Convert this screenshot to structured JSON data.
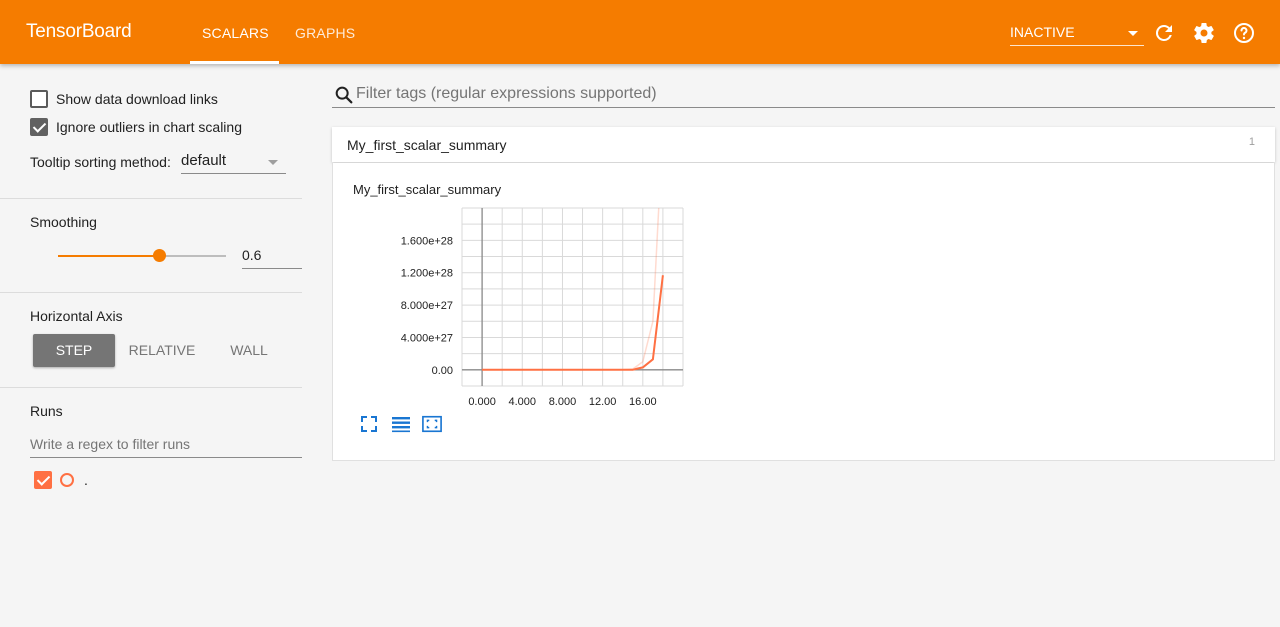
{
  "header": {
    "brand": "TensorBoard",
    "tabs": [
      {
        "label": "SCALARS",
        "active": true
      },
      {
        "label": "GRAPHS",
        "active": false
      }
    ],
    "run_select": "INACTIVE",
    "icons": [
      "refresh-icon",
      "settings-icon",
      "help-icon"
    ],
    "accent": "#f57c00"
  },
  "sidebar": {
    "show_download_links": {
      "label": "Show data download links",
      "checked": false
    },
    "ignore_outliers": {
      "label": "Ignore outliers in chart scaling",
      "checked": true
    },
    "tooltip_sort": {
      "label": "Tooltip sorting method:",
      "value": "default"
    },
    "smoothing": {
      "label": "Smoothing",
      "value": "0.6",
      "level": 0.6
    },
    "horizontal_axis": {
      "label": "Horizontal Axis",
      "options": [
        "STEP",
        "RELATIVE",
        "WALL"
      ],
      "selected": "STEP"
    },
    "runs": {
      "label": "Runs",
      "filter_placeholder": "Write a regex to filter runs",
      "items": [
        {
          "name": ".",
          "checked": true,
          "color": "#ff7043"
        }
      ]
    }
  },
  "main": {
    "search_placeholder": "Filter tags (regular expressions supported)",
    "category": {
      "title": "My_first_scalar_summary",
      "count": "1"
    },
    "card": {
      "title": "My_first_scalar_summary"
    },
    "card_tools": [
      "fit-domain-icon",
      "data-list-icon",
      "expand-chart-icon"
    ]
  },
  "chart_data": {
    "type": "line",
    "title": "My_first_scalar_summary",
    "xlabel": "",
    "ylabel": "",
    "x_ticks": [
      "0.000",
      "4.000",
      "8.000",
      "12.00",
      "16.00"
    ],
    "y_ticks": [
      "1.600e+28",
      "1.200e+28",
      "8.000e+27",
      "4.000e+27",
      "0.00"
    ],
    "xlim": [
      -2,
      20
    ],
    "ylim": [
      -2e+27,
      2e+28
    ],
    "grid": true,
    "series": [
      {
        "color": "#ff7043",
        "smoothed": true,
        "x": [
          0,
          1,
          2,
          3,
          4,
          5,
          6,
          7,
          8,
          9,
          10,
          11,
          12,
          13,
          14,
          15,
          16,
          17,
          18
        ],
        "y": [
          0,
          0,
          0,
          0,
          0,
          0,
          0,
          0,
          0,
          0,
          0,
          0,
          0,
          0,
          0,
          1e+25,
          3e+26,
          1.3e+27,
          1.17e+28
        ]
      },
      {
        "color": "#ff7043",
        "smoothed": false,
        "x": [
          0,
          1,
          2,
          3,
          4,
          5,
          6,
          7,
          8,
          9,
          10,
          11,
          12,
          13,
          14,
          15,
          16,
          17,
          18
        ],
        "y": [
          0,
          0,
          0,
          0,
          0,
          0,
          0,
          0,
          0,
          0,
          0,
          0,
          0,
          0,
          0,
          1e+26,
          1e+27,
          6e+27,
          3e+28
        ]
      }
    ]
  }
}
